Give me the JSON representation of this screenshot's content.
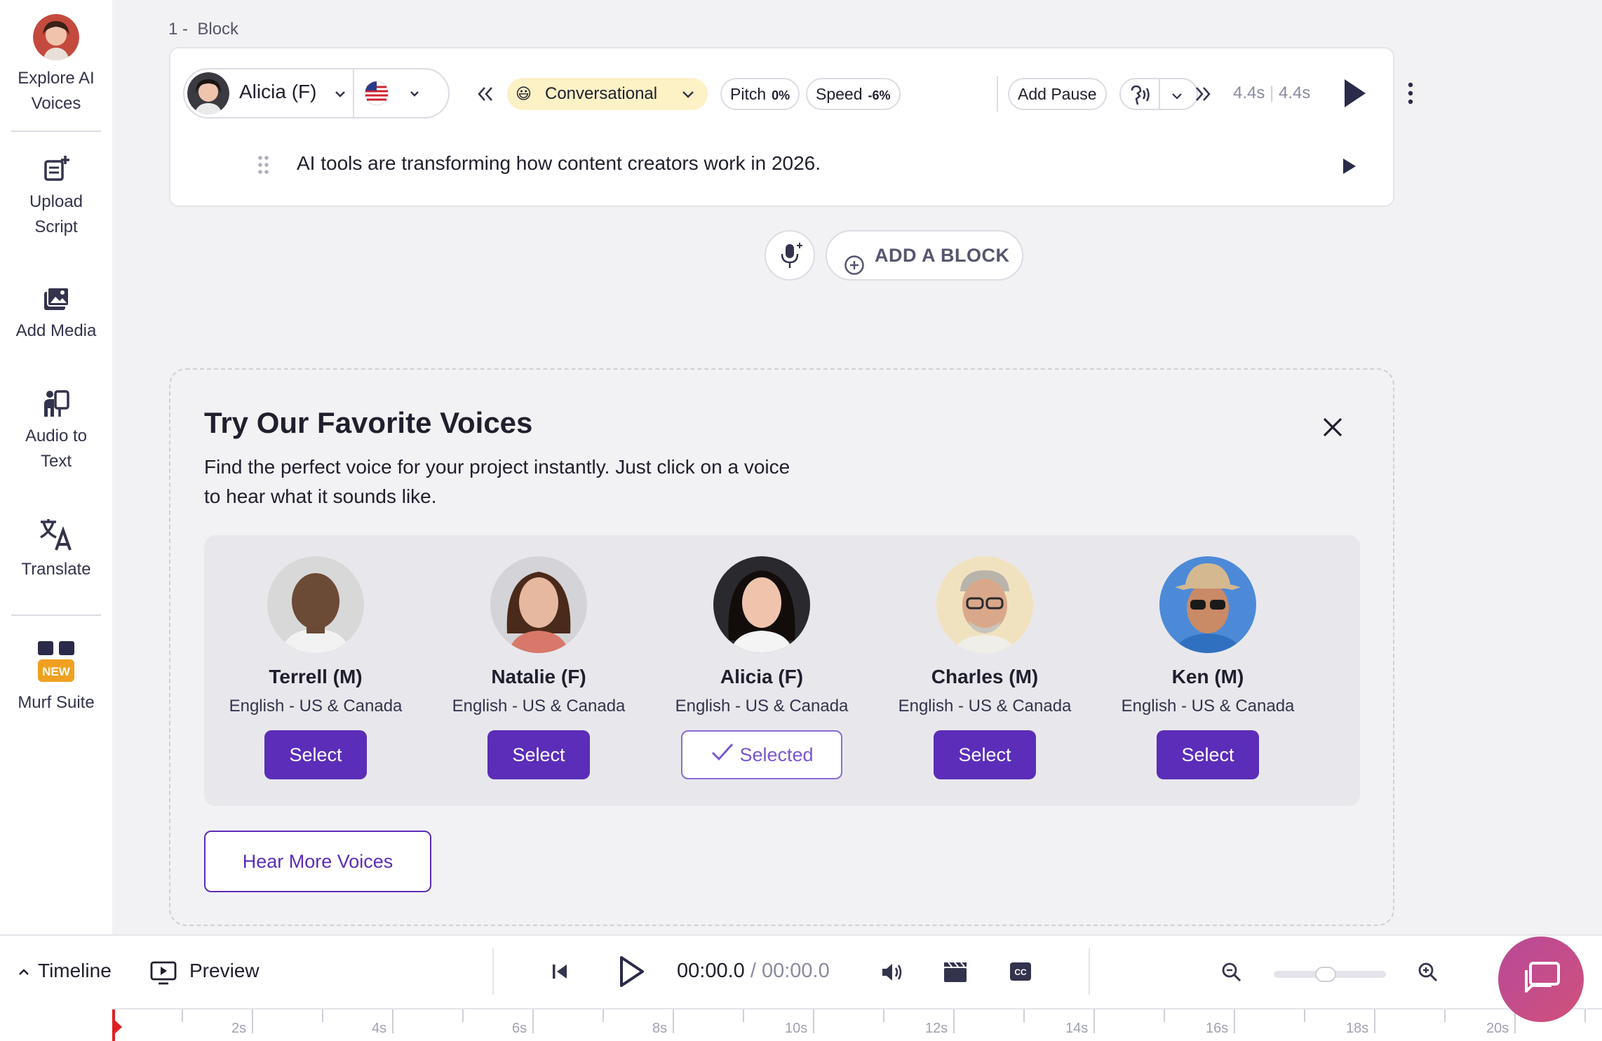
{
  "sidebar": {
    "items": [
      {
        "label_line1": "Explore AI",
        "label_line2": "Voices",
        "icon": "avatar-icon"
      },
      {
        "label_line1": "Upload",
        "label_line2": "Script",
        "icon": "upload-script-icon"
      },
      {
        "label_line1": "Add Media",
        "label_line2": "",
        "icon": "add-media-icon"
      },
      {
        "label_line1": "Audio to",
        "label_line2": "Text",
        "icon": "audio-to-text-icon"
      },
      {
        "label_line1": "Translate",
        "label_line2": "",
        "icon": "translate-icon"
      },
      {
        "label_line1": "Murf Suite",
        "label_line2": "",
        "icon": "murf-suite-icon",
        "badge": "NEW"
      }
    ]
  },
  "block": {
    "label_num": "1 -",
    "label_text": "Block",
    "voice_name": "Alicia (F)",
    "style": "Conversational",
    "style_emoji": "😃",
    "pitch_label": "Pitch",
    "pitch_value": "0%",
    "speed_label": "Speed",
    "speed_value": "-6%",
    "add_pause": "Add Pause",
    "time_current": "4.4s",
    "time_total": "4.4s",
    "script_text": "AI tools are transforming how content creators work in 2026."
  },
  "add_block": {
    "label": "ADD A BLOCK"
  },
  "favorites": {
    "title": "Try Our Favorite Voices",
    "subtitle": "Find the perfect voice for your project instantly. Just click on a voice to hear what it sounds like.",
    "voices": [
      {
        "name": "Terrell (M)",
        "lang": "English - US & Canada",
        "button": "Select",
        "selected": false,
        "skin": "#6b4a36",
        "bg": "#d8d8d8"
      },
      {
        "name": "Natalie (F)",
        "lang": "English - US & Canada",
        "button": "Select",
        "selected": false,
        "skin": "#e7b8a0",
        "bg": "#d4d4d8"
      },
      {
        "name": "Alicia (F)",
        "lang": "English - US & Canada",
        "button": "Selected",
        "selected": true,
        "skin": "#f0c4ac",
        "bg": "#2a2a2e"
      },
      {
        "name": "Charles (M)",
        "lang": "English - US & Canada",
        "button": "Select",
        "selected": false,
        "skin": "#d9a88a",
        "bg": "#f1e2bf"
      },
      {
        "name": "Ken (M)",
        "lang": "English - US & Canada",
        "button": "Select",
        "selected": false,
        "skin": "#c98a66",
        "bg": "#4c8ad8"
      }
    ],
    "hear_more": "Hear More Voices"
  },
  "bottom": {
    "timeline": "Timeline",
    "preview": "Preview",
    "time_current": "00:00.0",
    "time_sep": "/",
    "time_total": "00:00.0",
    "zoom_level": 0.45
  },
  "ruler": {
    "labels": [
      "2s",
      "4s",
      "6s",
      "8s",
      "10s",
      "12s",
      "14s",
      "16s",
      "18s",
      "20s"
    ]
  },
  "colors": {
    "accent": "#5b2db8",
    "style_pill": "#fdf1c6",
    "chat_gradient_start": "#b84a9a",
    "chat_gradient_end": "#d0507a"
  }
}
